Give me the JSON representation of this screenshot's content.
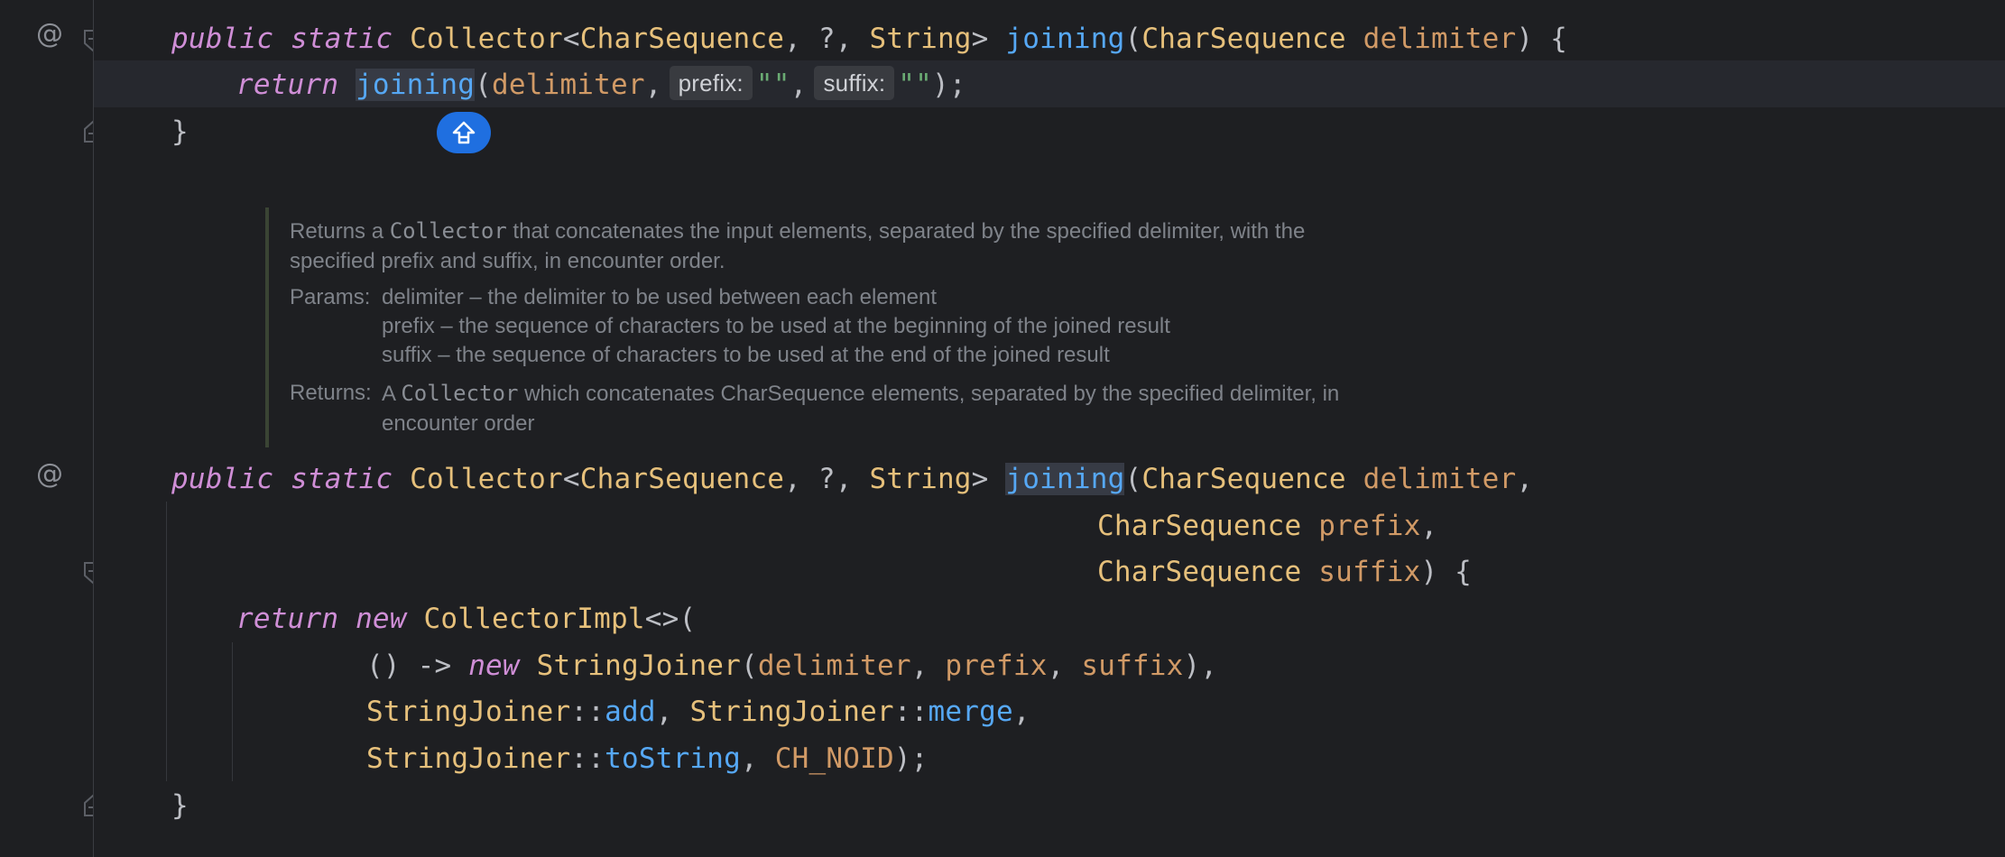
{
  "gutter": {
    "override_icon_1": "@",
    "override_icon_2": "@"
  },
  "method1": {
    "line1": {
      "kw1": "public",
      "kw2": "static",
      "type1": "Collector",
      "p1": "<",
      "type2": "CharSequence",
      "p2": ", ?, ",
      "type3": "String",
      "p3": "> ",
      "fn": "joining",
      "p4": "(",
      "type4": "CharSequence",
      "param": "delimiter",
      "p5": ") {"
    },
    "line2": {
      "kw": "return",
      "fn": "joining",
      "p1": "(",
      "arg": "delimiter",
      "p2": ",",
      "hint1": "prefix:",
      "str1": "\"\"",
      "p3": ",",
      "hint2": "suffix:",
      "str2": "\"\"",
      "p4": ");"
    },
    "line3": "}"
  },
  "javadoc": {
    "desc1_a": "Returns a ",
    "desc1_code": "Collector",
    "desc1_b": " that concatenates the input elements, separated by the specified delimiter, with the",
    "desc2": "specified prefix and suffix, in encounter order.",
    "params_label": "Params:",
    "param1": "delimiter – the delimiter to be used between each element",
    "param2": "prefix – the sequence of characters to be used at the beginning of the joined result",
    "param3": "suffix – the sequence of characters to be used at the end of the joined result",
    "returns_label": "Returns:",
    "returns1_a": "A ",
    "returns1_code": "Collector",
    "returns1_b": " which concatenates CharSequence elements, separated by the specified delimiter, in",
    "returns2": "encounter order"
  },
  "method2": {
    "line1": {
      "kw1": "public",
      "kw2": "static",
      "type1": "Collector",
      "p1": "<",
      "type2": "CharSequence",
      "p2": ", ?, ",
      "type3": "String",
      "p3": "> ",
      "fn": "joining",
      "p4": "(",
      "type4": "CharSequence",
      "param": "delimiter",
      "p5": ","
    },
    "line2": {
      "type": "CharSequence",
      "param": "prefix",
      "p": ","
    },
    "line3": {
      "type": "CharSequence",
      "param": "suffix",
      "p": ") {"
    },
    "line4": {
      "kw1": "return",
      "kw2": "new",
      "type": "CollectorImpl",
      "p": "<>("
    },
    "line5": {
      "p1": "() -> ",
      "kw": "new",
      "type": "StringJoiner",
      "p2": "(",
      "a1": "delimiter",
      "p3": ", ",
      "a2": "prefix",
      "p4": ", ",
      "a3": "suffix",
      "p5": "),"
    },
    "line6": {
      "type1": "StringJoiner",
      "p1": "::",
      "fn1": "add",
      "p2": ", ",
      "type2": "StringJoiner",
      "p3": "::",
      "fn2": "merge",
      "p4": ","
    },
    "line7": {
      "type": "StringJoiner",
      "p1": "::",
      "fn": "toString",
      "p2": ", ",
      "const": "CH_NOID",
      "p3": ");"
    },
    "line8": "}"
  },
  "colors": {
    "background": "#1e1f22",
    "keyword": "#cf8ed6",
    "type": "#e6c07b",
    "function": "#56a8f5",
    "parameter": "#d19a66",
    "string": "#6aab73",
    "badge": "#1f6fe0"
  },
  "icons": {
    "badge": "arrow-up-icon"
  }
}
